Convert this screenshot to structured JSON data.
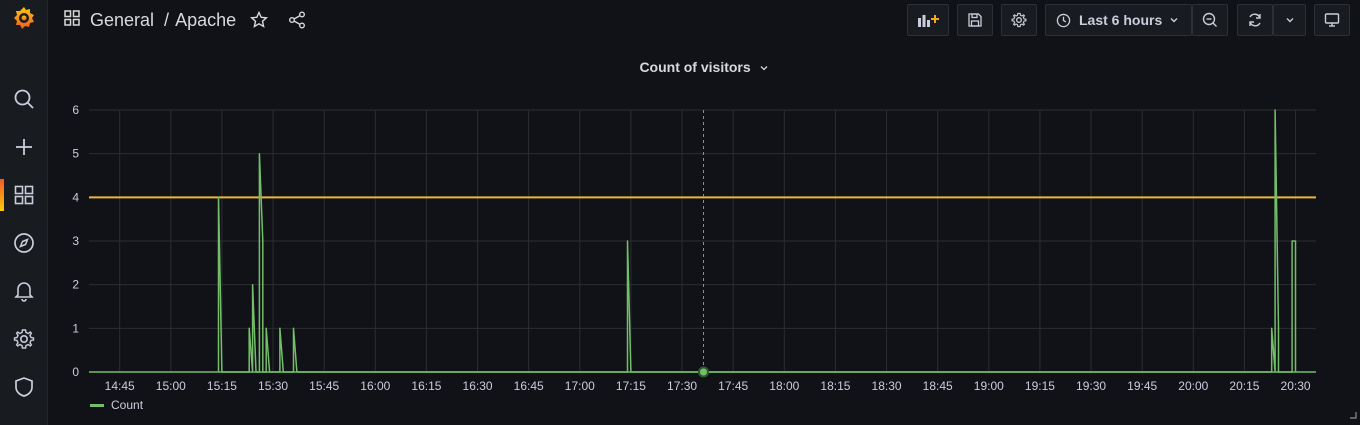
{
  "breadcrumb": {
    "folder": "General",
    "separator": "/",
    "dashboard": "Apache"
  },
  "timepicker": {
    "label": "Last 6 hours"
  },
  "panel": {
    "title": "Count of visitors"
  },
  "sidebar": {
    "items": [
      {
        "name": "search-icon"
      },
      {
        "name": "plus-icon"
      },
      {
        "name": "dashboards-icon",
        "active": true
      },
      {
        "name": "compass-icon"
      },
      {
        "name": "bell-icon"
      },
      {
        "name": "gear-icon"
      },
      {
        "name": "shield-icon"
      }
    ]
  },
  "colors": {
    "series": "#73bf69",
    "threshold": "#eab839",
    "grid": "#2b2d31",
    "accent": "#f05a28"
  },
  "chart_data": {
    "type": "line",
    "title": "Count of visitors",
    "x_ticks": [
      "14:45",
      "15:00",
      "15:15",
      "15:30",
      "15:45",
      "16:00",
      "16:15",
      "16:30",
      "16:45",
      "17:00",
      "17:15",
      "17:30",
      "17:45",
      "18:00",
      "18:15",
      "18:30",
      "18:45",
      "19:00",
      "19:15",
      "19:30",
      "19:45",
      "20:00",
      "20:15",
      "20:30"
    ],
    "y_ticks": [
      0,
      1,
      2,
      3,
      4,
      5,
      6
    ],
    "ylim": [
      0,
      6
    ],
    "xlim": [
      "14:36",
      "20:36"
    ],
    "grid": true,
    "legend": "bottom-left",
    "threshold": 4,
    "series": [
      {
        "name": "Count",
        "color": "#73bf69",
        "points": [
          {
            "x": "15:14",
            "y": 0
          },
          {
            "x": "15:14",
            "y": 4
          },
          {
            "x": "15:15",
            "y": 0
          },
          {
            "x": "15:23",
            "y": 0
          },
          {
            "x": "15:23",
            "y": 1
          },
          {
            "x": "15:24",
            "y": 0
          },
          {
            "x": "15:24",
            "y": 0
          },
          {
            "x": "15:24",
            "y": 2
          },
          {
            "x": "15:25",
            "y": 0
          },
          {
            "x": "15:26",
            "y": 0
          },
          {
            "x": "15:26",
            "y": 5
          },
          {
            "x": "15:27",
            "y": 3
          },
          {
            "x": "15:27",
            "y": 0
          },
          {
            "x": "15:28",
            "y": 0
          },
          {
            "x": "15:28",
            "y": 1
          },
          {
            "x": "15:29",
            "y": 0
          },
          {
            "x": "15:32",
            "y": 0
          },
          {
            "x": "15:32",
            "y": 1
          },
          {
            "x": "15:33",
            "y": 0
          },
          {
            "x": "15:36",
            "y": 0
          },
          {
            "x": "15:36",
            "y": 1
          },
          {
            "x": "15:37",
            "y": 0
          },
          {
            "x": "17:14",
            "y": 0
          },
          {
            "x": "17:14",
            "y": 1
          },
          {
            "x": "17:14",
            "y": 3
          },
          {
            "x": "17:15",
            "y": 0
          },
          {
            "x": "20:23",
            "y": 0
          },
          {
            "x": "20:23",
            "y": 1
          },
          {
            "x": "20:24",
            "y": 0
          },
          {
            "x": "20:24",
            "y": 0
          },
          {
            "x": "20:24",
            "y": 6
          },
          {
            "x": "20:25",
            "y": 1
          },
          {
            "x": "20:25",
            "y": 0
          },
          {
            "x": "20:29",
            "y": 0
          },
          {
            "x": "20:29",
            "y": 3
          },
          {
            "x": "20:30",
            "y": 3
          },
          {
            "x": "20:30",
            "y": 0
          }
        ]
      }
    ]
  }
}
